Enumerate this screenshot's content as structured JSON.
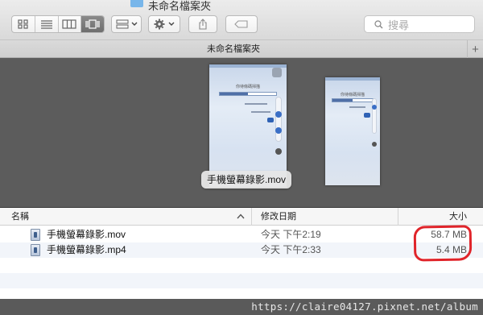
{
  "window": {
    "title": "未命名檔案夾"
  },
  "toolbar": {
    "view_buttons": [
      {
        "icon": "icon-view-icon",
        "active": false
      },
      {
        "icon": "list-view-icon",
        "active": false
      },
      {
        "icon": "column-view-icon",
        "active": false
      },
      {
        "icon": "cover-flow-view-icon",
        "active": true
      }
    ],
    "arrange_icon": "grid-icon",
    "action_icon": "gear-icon",
    "share_icon": "share-icon",
    "tag_icon": "tag-icon",
    "search_placeholder": "搜尋"
  },
  "tabbar": {
    "title": "未命名檔案夾",
    "add_label": "+"
  },
  "preview": {
    "caption": "手機螢幕錄影.mov",
    "phone_header_text": "你待條碼掃描"
  },
  "list": {
    "headers": {
      "name": "名稱",
      "date": "修改日期",
      "size": "大小"
    },
    "rows": [
      {
        "name": "手機螢幕錄影.mov",
        "date": "今天 下午2:19",
        "size": "58.7 MB"
      },
      {
        "name": "手機螢幕錄影.mp4",
        "date": "今天 下午2:33",
        "size": "5.4 MB"
      }
    ]
  },
  "watermark": "https://claire04127.pixnet.net/album",
  "colors": {
    "annotation": "#e0242a",
    "preview_bg": "#5c5c5c",
    "folder": "#78b6ea"
  }
}
